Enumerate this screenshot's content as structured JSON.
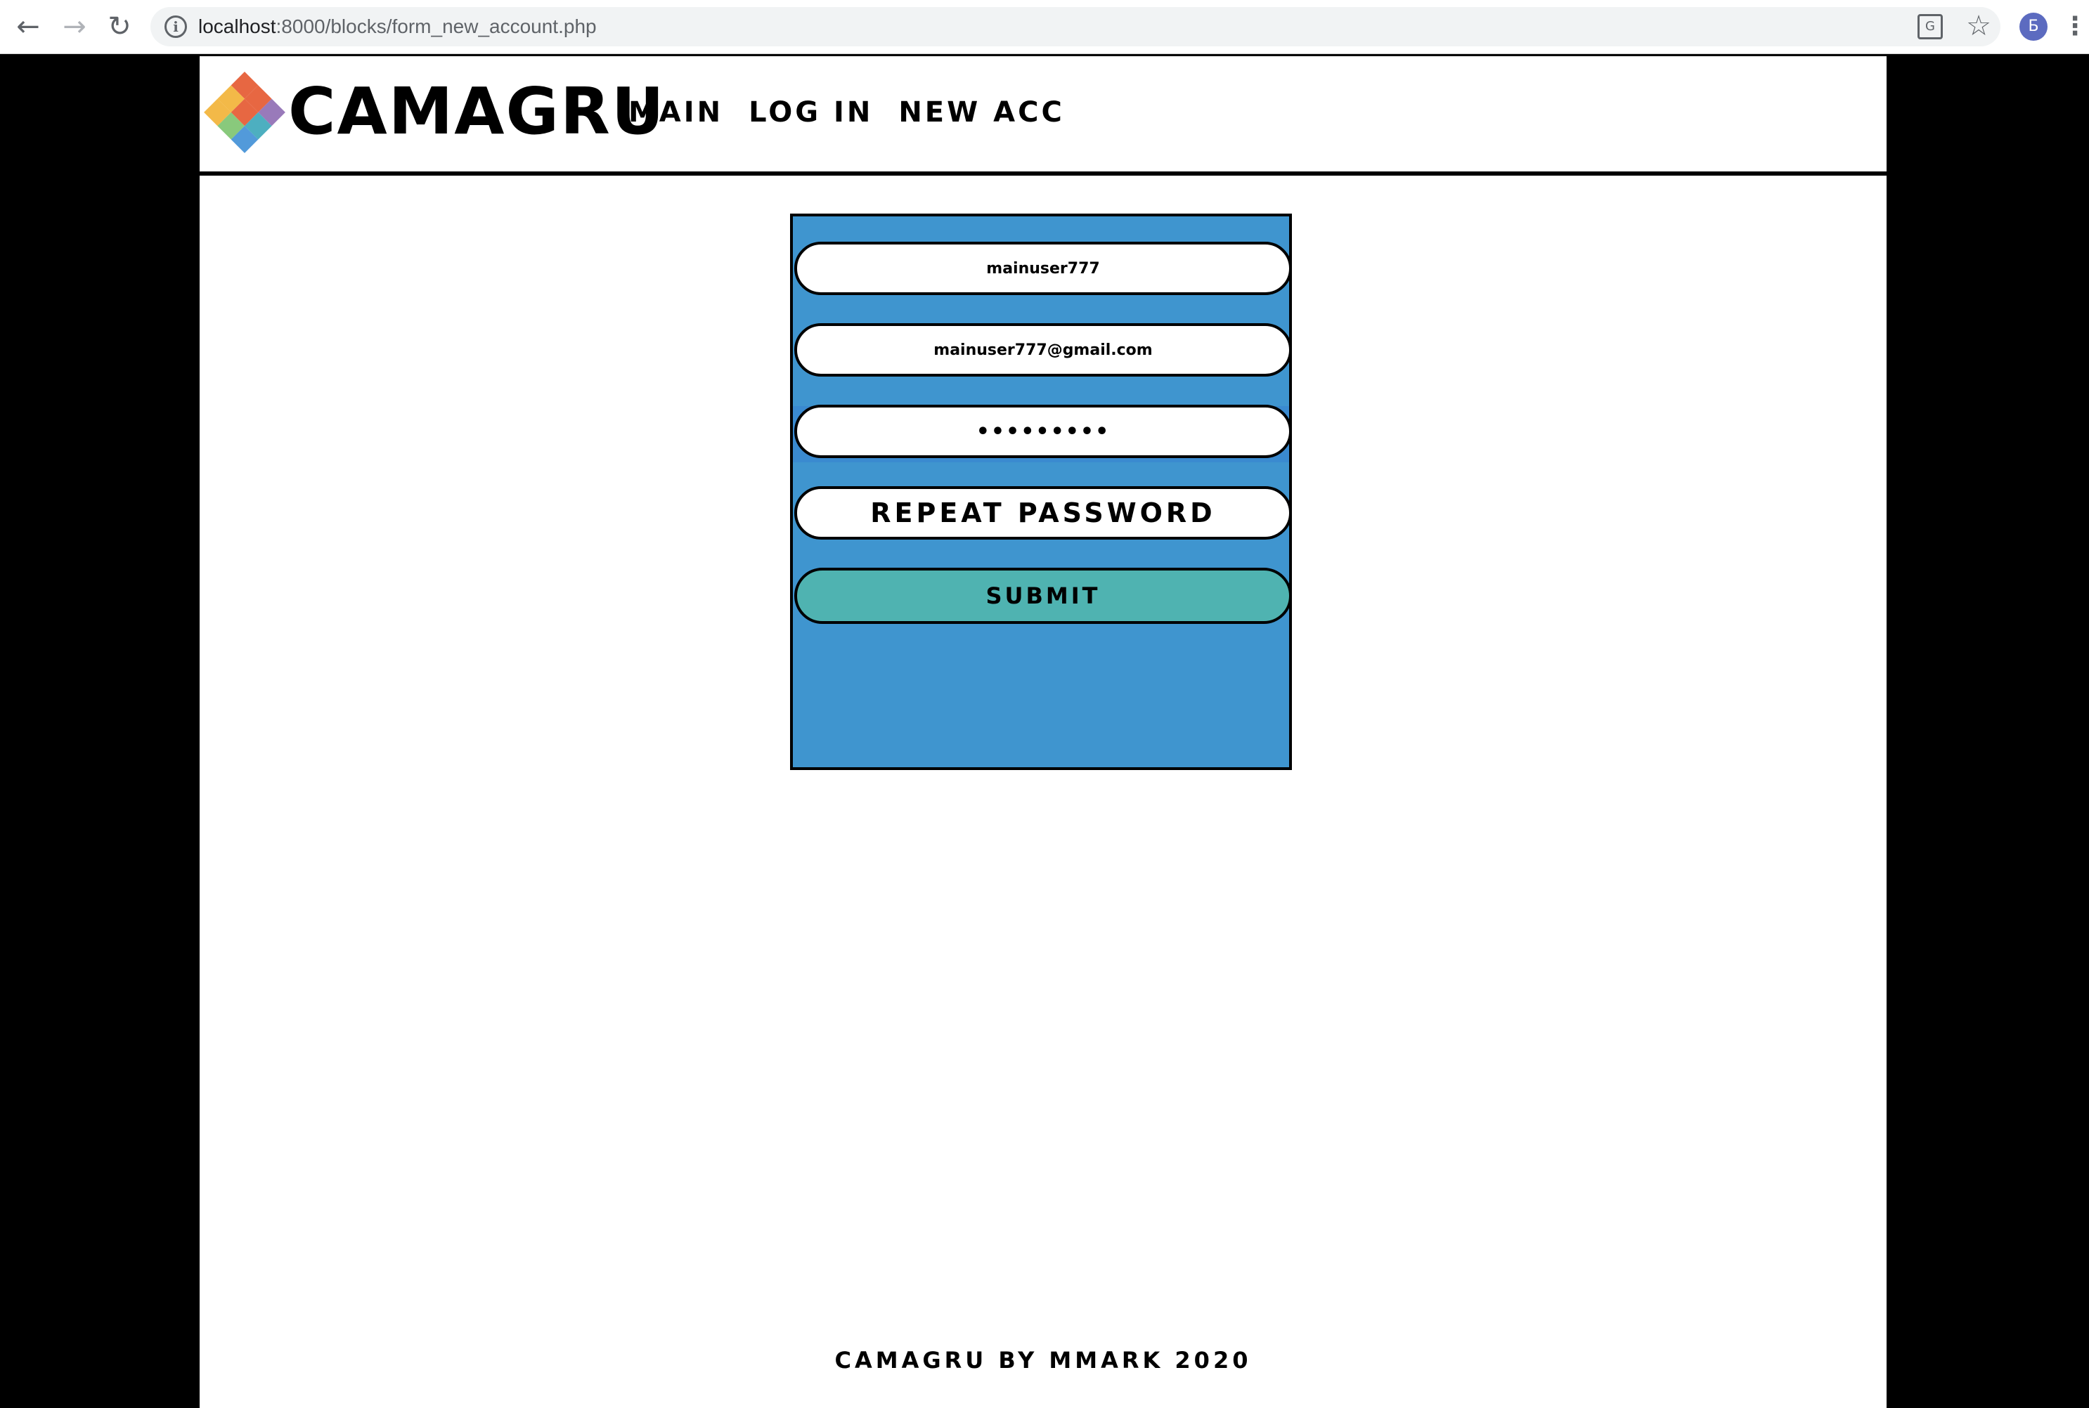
{
  "browser": {
    "url_host": "localhost",
    "url_rest": ":8000/blocks/form_new_account.php",
    "back_icon": "←",
    "forward_icon": "→",
    "reload_icon": "↻",
    "info_icon": "i",
    "translate_icon": "G",
    "star_icon": "☆",
    "avatar_letter": "Б",
    "menu_icon": "⋮"
  },
  "header": {
    "logo_text": "CAMAGRU",
    "nav": [
      "MAIN",
      "LOG IN",
      "NEW ACC"
    ],
    "logo_colors": [
      "#e4572e",
      "#8e6bb3",
      "#f2b134",
      "#3aa6b9",
      "#7cc36e",
      "#3f8fd6"
    ]
  },
  "form": {
    "login_value": "mainuser777",
    "email_value": "mainuser777@gmail.com",
    "password_value": "123456789",
    "repeat_placeholder": "REPEAT PASSWORD",
    "submit_label": "SUBMIT",
    "box_color": "#3f95cf",
    "submit_color": "#4fb3b1"
  },
  "footer": {
    "text": "CAMAGRU BY MMARK 2020"
  }
}
